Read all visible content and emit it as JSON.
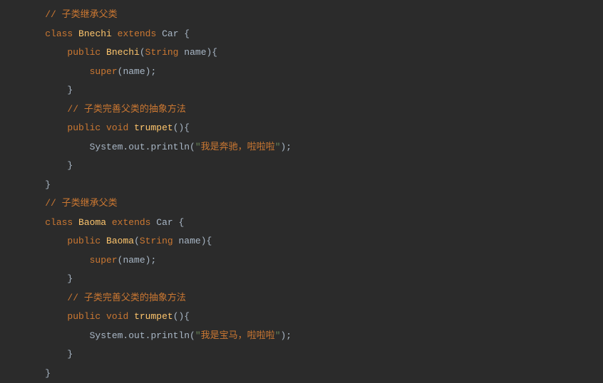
{
  "code": {
    "line1_comment": "// 子类继承父类",
    "line2_class": "class",
    "line2_name": "Bnechi",
    "line2_extends": "extends",
    "line2_parent": "Car",
    "line2_brace": " {",
    "line3_public": "public",
    "line3_ctor": "Bnechi",
    "line3_paren_open": "(",
    "line3_type": "String",
    "line3_param": " name",
    "line3_paren_close": "){",
    "line4_super": "super",
    "line4_args": "(name);",
    "line5_brace": "}",
    "line6_comment": "// 子类完善父类的抽象方法",
    "line7_public": "public",
    "line7_void": "void",
    "line7_method": "trumpet",
    "line7_parens": "(){",
    "line8_sysout": "System.out.println(",
    "line8_str_open": "\"",
    "line8_str_cn": "我是奔驰，啦啦啦",
    "line8_str_close": "\"",
    "line8_end": ");",
    "line9_brace": "}",
    "line10_brace": "}",
    "line11_comment": "// 子类继承父类",
    "line12_class": "class",
    "line12_name": "Baoma",
    "line12_extends": "extends",
    "line12_parent": "Car",
    "line12_brace": " {",
    "line13_public": "public",
    "line13_ctor": "Baoma",
    "line13_paren_open": "(",
    "line13_type": "String",
    "line13_param": " name",
    "line13_paren_close": "){",
    "line14_super": "super",
    "line14_args": "(name);",
    "line15_brace": "}",
    "line16_comment": "// 子类完善父类的抽象方法",
    "line17_public": "public",
    "line17_void": "void",
    "line17_method": "trumpet",
    "line17_parens": "(){",
    "line18_sysout": "System.out.println(",
    "line18_str_open": "\"",
    "line18_str_cn": "我是宝马，啦啦啦",
    "line18_str_close": "\"",
    "line18_end": ");",
    "line19_brace": "}",
    "line20_brace": "}"
  }
}
